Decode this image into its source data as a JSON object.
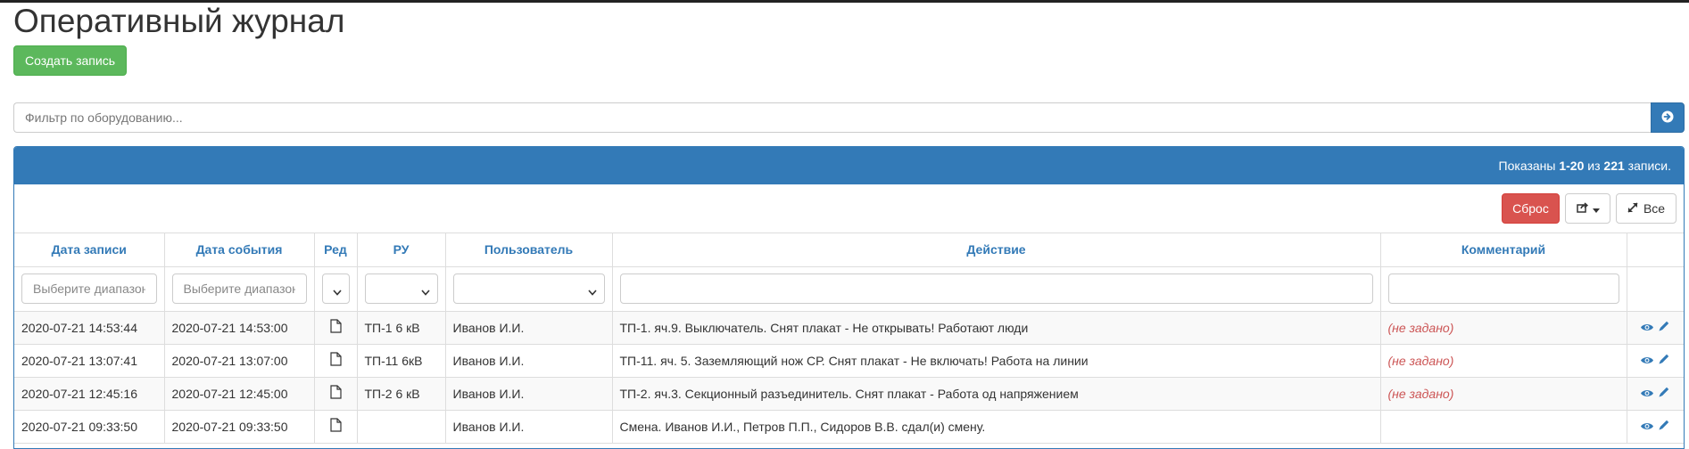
{
  "page": {
    "title": "Оперативный журнал",
    "create_label": "Создать запись"
  },
  "filter": {
    "placeholder": "Фильтр по оборудованию..."
  },
  "summary": {
    "prefix": "Показаны ",
    "range": "1-20",
    "mid": " из ",
    "total": "221",
    "suffix": " записи."
  },
  "toolbar": {
    "reset_label": "Сброс",
    "all_label": "Все"
  },
  "table": {
    "columns": [
      "Дата записи",
      "Дата события",
      "Ред",
      "РУ",
      "Пользователь",
      "Действие",
      "Комментарий"
    ],
    "date_placeholder": "Выберите диапазон",
    "not_set": "(не задано)",
    "rows": [
      {
        "rec_date": "2020-07-21 14:53:44",
        "event_date": "2020-07-21 14:53:00",
        "ru": "ТП-1 6 кВ",
        "user": "Иванов И.И.",
        "action": "ТП-1. яч.9. Выключатель. Снят плакат - Не открывать! Работают люди",
        "comment": "(не задано)"
      },
      {
        "rec_date": "2020-07-21 13:07:41",
        "event_date": "2020-07-21 13:07:00",
        "ru": "ТП-11 6кВ",
        "user": "Иванов И.И.",
        "action": "ТП-11. яч. 5. Заземляющий нож СР. Снят плакат - Не включать! Работа на линии",
        "comment": "(не задано)"
      },
      {
        "rec_date": "2020-07-21 12:45:16",
        "event_date": "2020-07-21 12:45:00",
        "ru": "ТП-2 6 кВ",
        "user": "Иванов И.И.",
        "action": "ТП-2. яч.3. Секционный разъединитель. Снят плакат - Работа од напряжением",
        "comment": "(не задано)"
      },
      {
        "rec_date": "2020-07-21 09:33:50",
        "event_date": "2020-07-21 09:33:50",
        "ru": "",
        "user": "Иванов И.И.",
        "action": "Смена. Иванов И.И., Петров П.П., Сидоров В.В. сдал(и) смену.",
        "comment": ""
      }
    ]
  },
  "colors": {
    "primary": "#337ab7",
    "success": "#5cb85c",
    "danger": "#d9534f",
    "not_set": "#cc5555"
  },
  "icons": [
    "arrow-circle-right-icon",
    "export-icon",
    "caret-down-icon",
    "expand-icon",
    "file-icon",
    "eye-icon",
    "pencil-icon"
  ]
}
